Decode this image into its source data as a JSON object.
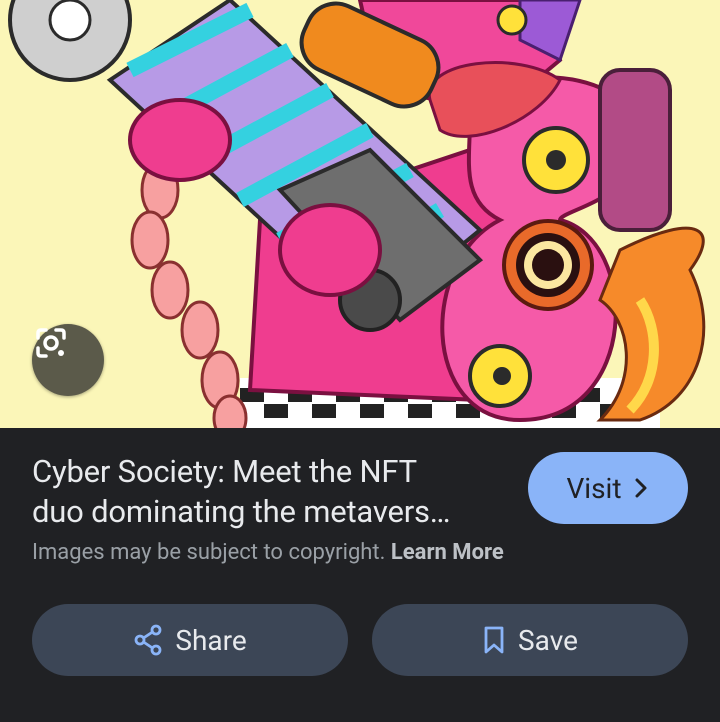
{
  "title_line1": "Cyber Society: Meet the NFT",
  "title_line2": "duo dominating the metavers…",
  "visit_label": "Visit",
  "copyright_text": "Images may be subject to copyright.",
  "learn_more_label": "Learn More",
  "share_label": "Share",
  "save_label": "Save",
  "colors": {
    "background": "#202124",
    "accent": "#8ab4f8",
    "button_bg": "#3c4656",
    "image_bg": "#fbf6b8"
  },
  "icons": [
    "lens-icon",
    "chevron-right-icon",
    "share-icon",
    "bookmark-icon"
  ]
}
